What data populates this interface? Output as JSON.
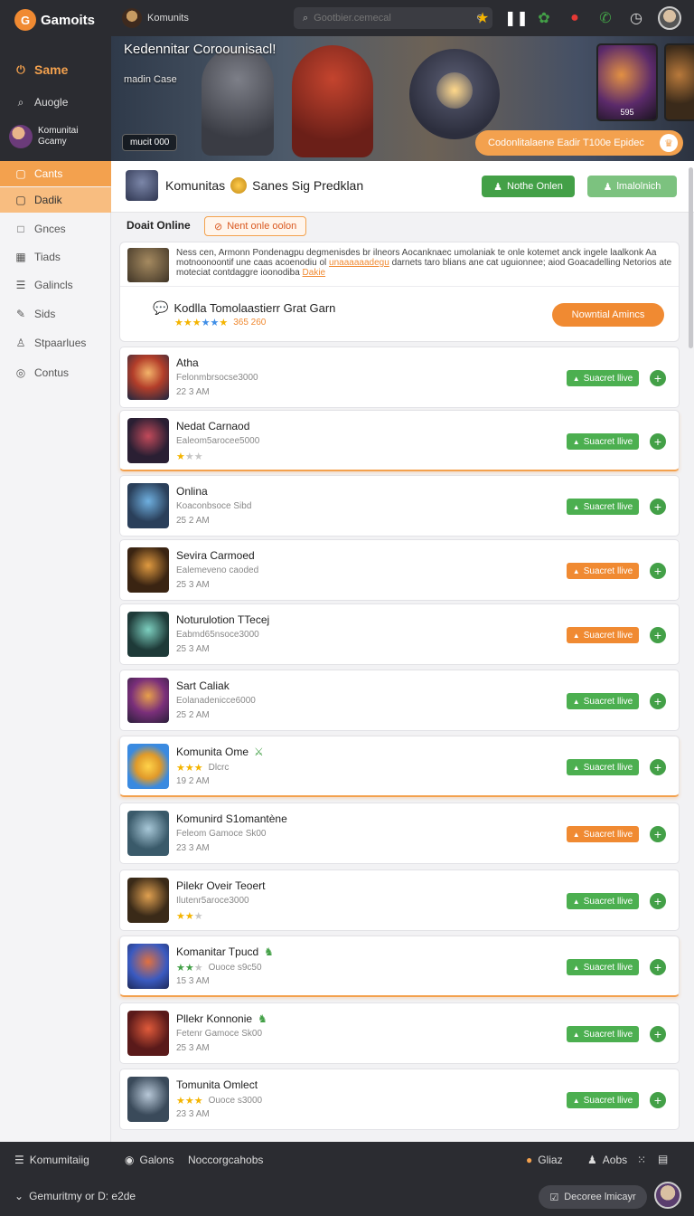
{
  "app": {
    "name": "Gamoits",
    "logo_glyph": "G"
  },
  "sidebar": {
    "items": [
      {
        "label": "Same",
        "icon": "power-icon"
      },
      {
        "label": "Auogle",
        "icon": "search-icon"
      }
    ],
    "profile": {
      "line1": "Komunitai",
      "line2": "Gcamy"
    },
    "nav": [
      {
        "label": "Cants",
        "icon": "card-icon"
      },
      {
        "label": "Dadik",
        "icon": "square-icon"
      },
      {
        "label": "Gnces",
        "icon": "square-outline-icon"
      },
      {
        "label": "Tiads",
        "icon": "grid-icon"
      },
      {
        "label": "Galincls",
        "icon": "list-icon"
      },
      {
        "label": "Sids",
        "icon": "edit-icon"
      },
      {
        "label": "Stpaarlues",
        "icon": "user-icon"
      },
      {
        "label": "Contus",
        "icon": "circle-icon"
      }
    ]
  },
  "topbar": {
    "user": "Komunits",
    "search_placeholder": "Gootbier.cemecal"
  },
  "hero": {
    "title": "Kedennitar Coroounisacl!",
    "subtitle": "madin Case",
    "chip": "mucit 000",
    "thumb_caption": "595",
    "cta": "Codonlitalaene Eadir T100e Epidec"
  },
  "community": {
    "title": "Komunitas",
    "title2": "Sanes Sig Predklan",
    "btn_primary": "Nothe Onlen",
    "btn_secondary": "lmalolnich"
  },
  "section": {
    "label": "Doait Online",
    "warning": "Nent onle oolon"
  },
  "featured": {
    "description": "Ness cen, Armonn Pondenagpu degmenisdes br ilneors Aocanknaec umolaniak te onle kotemet anck ingele laalkonk Aa motnoonoontif une caas acoenodiu ol",
    "highlight": "unaaaaaadegu",
    "description2": "darnets taro blians ane cat uguionnee; aiod Goacadelling Netorios ate moteciat contdaggre ioonodiba",
    "highlight2": "Dakie",
    "name": "Kodlla Tomolaastierr Grat Garn",
    "rating_meta": "365 260",
    "button": "Nowntial Amincs"
  },
  "list": [
    {
      "title": "Atha",
      "sub": "Felonmbrsocse3000",
      "time": "22 3 AM",
      "status": "Suacret llive",
      "status_color": "green",
      "highlight": false
    },
    {
      "title": "Nedat Carnaod",
      "sub": "Ealeom5arocee5000",
      "time": "",
      "stars": 1,
      "status": "Suacret llive",
      "status_color": "green",
      "highlight": true
    },
    {
      "title": "Onlina",
      "sub": "Koaconbsoce Sibd",
      "time": "25 2 AM",
      "status": "Suacret llive",
      "status_color": "green",
      "highlight": false
    },
    {
      "title": "Sevira Carmoed",
      "sub": "Ealemeveno caoded",
      "time": "25 3 AM",
      "status": "Suacret llive",
      "status_color": "orange",
      "highlight": false
    },
    {
      "title": "Noturulotion TTecej",
      "sub": "Eabmd65nsoce3000",
      "time": "25 3 AM",
      "status": "Suacret llive",
      "status_color": "orange",
      "highlight": false
    },
    {
      "title": "Sart Caliak",
      "sub": "Eolanadenicce6000",
      "time": "25 2 AM",
      "status": "Suacret llive",
      "status_color": "green",
      "highlight": false
    },
    {
      "title": "Komunita  Ome",
      "tag": "⚔",
      "stars": 3,
      "stars_meta": "Dlcrc",
      "time": "19 2 AM",
      "status": "Suacret llive",
      "status_color": "green",
      "highlight": true
    },
    {
      "title": "Komunird S1omantène",
      "sub": "Feleom Gamoce Sk00",
      "time": "23 3 AM",
      "status": "Suacret llive",
      "status_color": "orange",
      "highlight": false
    },
    {
      "title": "Pilekr Oveir Teoert",
      "sub": "Ilutenr5aroce3000",
      "time": "",
      "stars": 2,
      "status": "Suacret llive",
      "status_color": "green",
      "highlight": false
    },
    {
      "title": "Komanitar Tpucd",
      "tag": "♞",
      "stars": 2,
      "stars_green": true,
      "stars_meta": "Ouoce s9c50",
      "time": "15 3 AM",
      "status": "Suacret llive",
      "status_color": "green",
      "highlight": true
    },
    {
      "title": "Pllekr Konnonie",
      "tag": "♞",
      "sub": "Fetenr Gamoce Sk00",
      "time": "25 3 AM",
      "status": "Suacret llive",
      "status_color": "green",
      "highlight": false
    },
    {
      "title": "Tomunita Omlect",
      "stars": 3,
      "stars_meta": "Ouoce s3000",
      "time": "23 3 AM",
      "status": "Suacret llive",
      "status_color": "green",
      "highlight": false
    }
  ],
  "bottombar": {
    "item1": "Komumitaiig",
    "item2": "Galons",
    "item3": "Noccorgcahobs",
    "item4": "Gliaz",
    "item5": "Aobs",
    "footer": "Gemuritmy or D: e2de",
    "pill": "Decoree lmicayr"
  },
  "colors": {
    "accent": "#f3a14e",
    "green": "#43a047",
    "dark": "#2b2c31"
  }
}
